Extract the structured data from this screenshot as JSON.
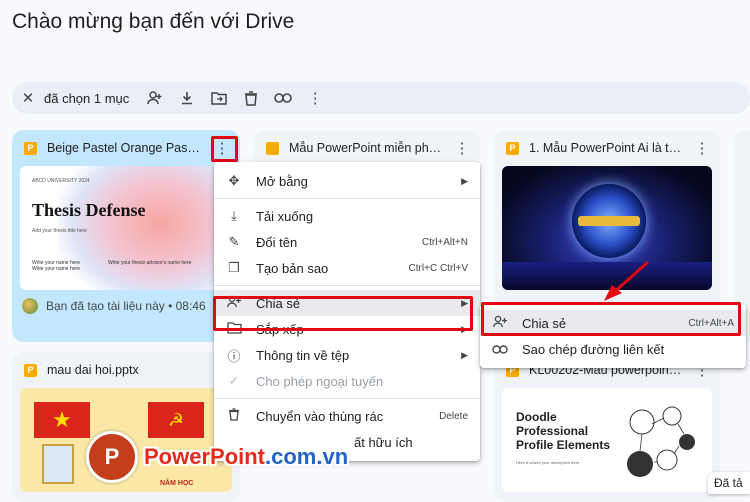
{
  "page_title": "Chào mừng bạn đến với Drive",
  "selection_bar": {
    "count_label": "đã chọn 1 mục",
    "icons": [
      "close-icon",
      "add-person-icon",
      "download-icon",
      "move-folder-icon",
      "trash-icon",
      "link-icon",
      "more-vert-icon"
    ]
  },
  "cards": [
    {
      "name": "Beige Pastel Orange Pastel P...",
      "file_type": "P",
      "footer": "Bạn đã tạo tài liệu này • 08:46"
    },
    {
      "name": "Mẫu PowerPoint miễn phí cự...",
      "file_type": ""
    },
    {
      "name": "1. Mẫu PowerPoint Ai là triệu ...",
      "file_type": "P"
    },
    {
      "name": "mau dai hoi.pptx",
      "file_type": "P"
    },
    {
      "name": "KL00202-Mẫu powerpoint k...",
      "file_type": "P"
    }
  ],
  "thumb1": {
    "header": "ABCD UNIVERSITY 2024",
    "title": "Thesis Defense",
    "subtitle": "Add your thesis title here",
    "name_line": "Write your name here",
    "advisor_line": "Write your thesis advisor's name here",
    "extra_line": "Write your name here"
  },
  "thumb5": {
    "title_lines": [
      "Doodle",
      "Professional",
      "Profile Elements"
    ],
    "sub": "Here is where your description here"
  },
  "thumb4": {
    "label": "NĂM HỌC"
  },
  "context_menu": {
    "items": [
      {
        "icon": "open-with-icon",
        "label": "Mở bằng",
        "shortcut": "",
        "submenu": true,
        "disabled": false
      },
      {
        "sep": true
      },
      {
        "icon": "download-icon",
        "label": "Tải xuống",
        "shortcut": "",
        "submenu": false,
        "disabled": false
      },
      {
        "icon": "rename-icon",
        "label": "Đổi tên",
        "shortcut": "Ctrl+Alt+N",
        "submenu": false,
        "disabled": false
      },
      {
        "icon": "copy-icon",
        "label": "Tạo bản sao",
        "shortcut": "Ctrl+C Ctrl+V",
        "submenu": false,
        "disabled": false
      },
      {
        "sep": true
      },
      {
        "icon": "share-icon",
        "label": "Chia sẻ",
        "shortcut": "",
        "submenu": true,
        "disabled": false,
        "highlight": true
      },
      {
        "icon": "folder-icon",
        "label": "Sắp xếp",
        "shortcut": "",
        "submenu": true,
        "disabled": false
      },
      {
        "icon": "info-icon",
        "label": "Thông tin về tệp",
        "shortcut": "",
        "submenu": true,
        "disabled": false
      },
      {
        "icon": "offline-icon",
        "label": "Cho phép ngoại tuyến",
        "shortcut": "",
        "submenu": false,
        "disabled": true
      },
      {
        "sep": true
      },
      {
        "icon": "trash-icon",
        "label": "Chuyển vào thùng rác",
        "shortcut": "Delete",
        "submenu": false,
        "disabled": false
      },
      {
        "icon": "link-icon",
        "label": "ất hữu ích",
        "shortcut": "",
        "submenu": false,
        "disabled": false
      }
    ]
  },
  "submenu": {
    "items": [
      {
        "icon": "share-icon",
        "label": "Chia sẻ",
        "shortcut": "Ctrl+Alt+A",
        "highlight": true
      },
      {
        "icon": "link-icon",
        "label": "Sao chép đường liên kết",
        "shortcut": ""
      }
    ]
  },
  "watermark": {
    "brand": "PowerPoint",
    "domain": ".com.vn",
    "glyph": "P"
  },
  "partial_text": "Đã tả",
  "colors": {
    "highlight_red": "#e30613",
    "selected_card": "#c2e7ff",
    "arrow": "#e30613"
  }
}
